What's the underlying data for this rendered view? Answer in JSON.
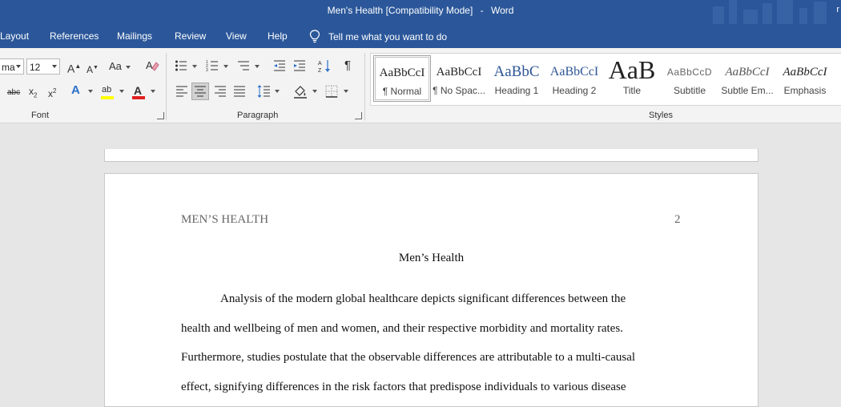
{
  "window": {
    "doc_name": "Men's Health [Compatibility Mode]",
    "separator": "-",
    "app_name": "Word",
    "user_partial": "r"
  },
  "tabs": [
    {
      "label": "Layout"
    },
    {
      "label": "References"
    },
    {
      "label": "Mailings"
    },
    {
      "label": "Review"
    },
    {
      "label": "View"
    },
    {
      "label": "Help"
    }
  ],
  "tellme": {
    "label": "Tell me what you want to do",
    "icon": "lightbulb-icon"
  },
  "font_group": {
    "font_name": "ma",
    "font_size": "12",
    "grow_label": "A",
    "shrink_label": "A",
    "case_label": "Aa",
    "strike_label": "abc",
    "sub_label": "x",
    "sub_suffix": "2",
    "sup_label": "x",
    "sup_suffix": "2",
    "effects_label": "A",
    "highlight_label": "ab",
    "font_color_label": "A",
    "label": "Font",
    "highlight_color": "#ffff00",
    "font_color": "#e02020"
  },
  "paragraph_group": {
    "label": "Paragraph",
    "pilcrow": "¶"
  },
  "styles_group": {
    "label": "Styles",
    "items": [
      {
        "preview": "AaBbCcI",
        "name": "¶ Normal",
        "selected": true
      },
      {
        "preview": "AaBbCcI",
        "name": "¶ No Spac..."
      },
      {
        "preview": "AaBbC",
        "name": "Heading 1"
      },
      {
        "preview": "AaBbCcI",
        "name": "Heading 2"
      },
      {
        "preview": "AaB",
        "name": "Title"
      },
      {
        "preview": "AaBbCcD",
        "name": "Subtitle"
      },
      {
        "preview": "AaBbCcI",
        "name": "Subtle Em..."
      },
      {
        "preview": "AaBbCcI",
        "name": "Emphasis"
      }
    ]
  },
  "document": {
    "header_text": "MEN’S HEALTH",
    "page_number": "2",
    "title": "Men’s Health",
    "lines": [
      "Analysis of the modern global healthcare depicts significant differences between the",
      "health and wellbeing of men and women, and their respective morbidity and mortality rates.",
      "Furthermore, studies postulate that the observable differences are attributable to a multi-causal",
      "effect, signifying differences in the risk factors that predispose individuals to various disease"
    ]
  }
}
